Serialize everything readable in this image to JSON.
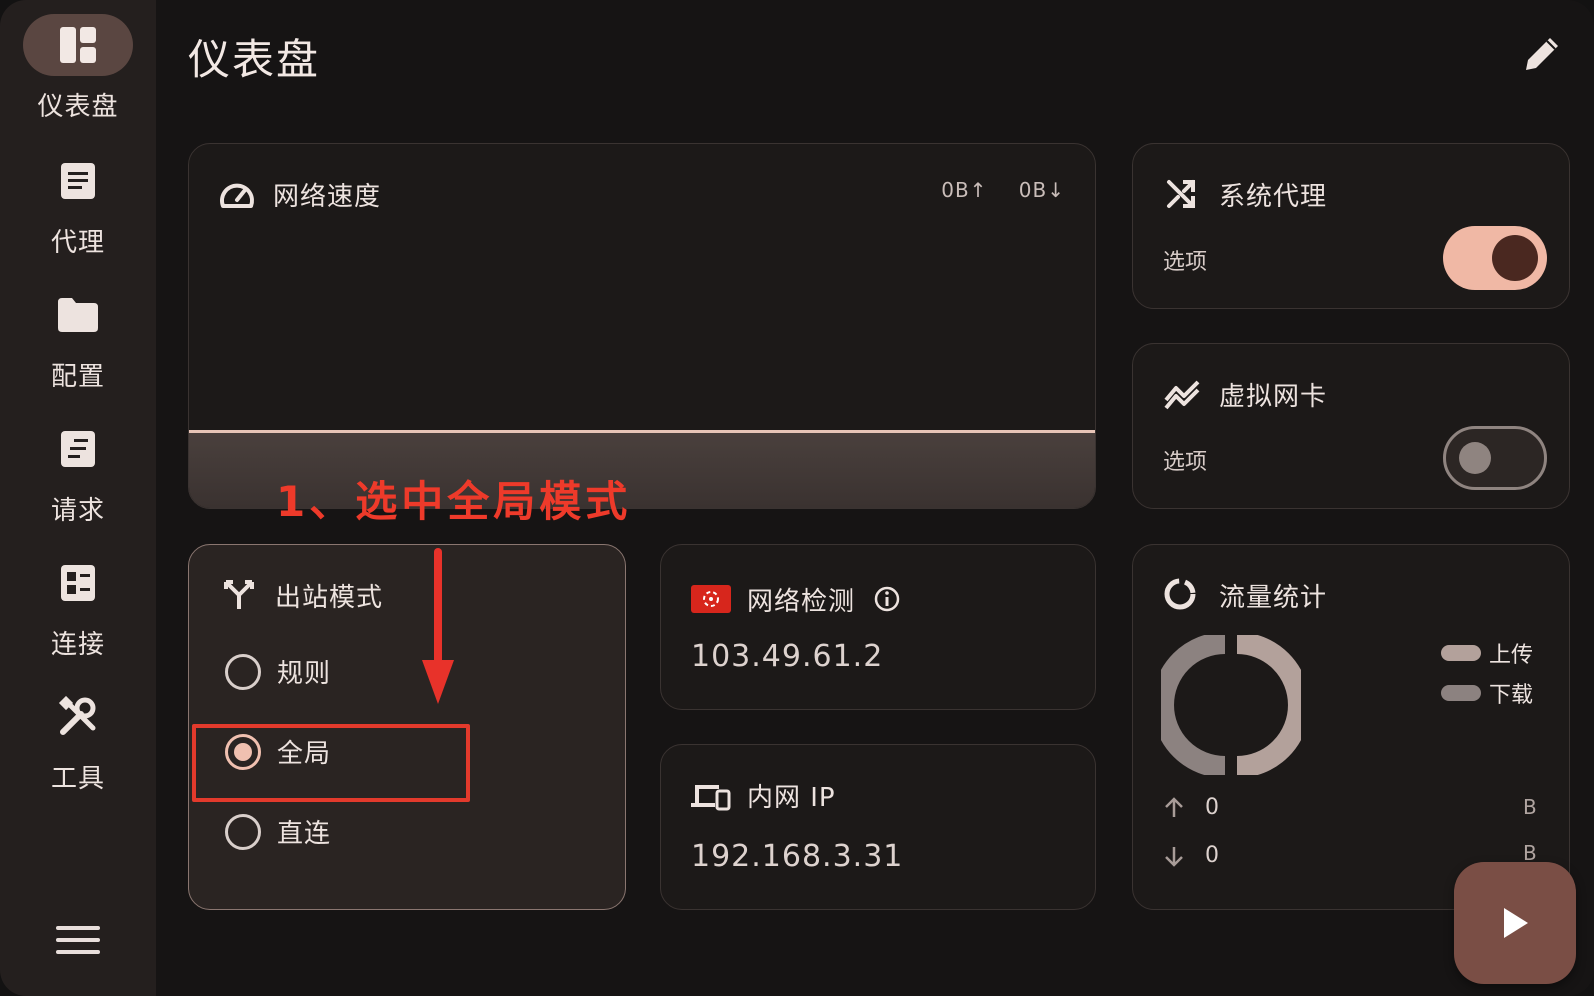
{
  "page": {
    "title": "仪表盘"
  },
  "sidebar": {
    "items": [
      {
        "label": "仪表盘",
        "icon": "dashboard-icon",
        "active": true
      },
      {
        "label": "代理",
        "icon": "proxy-list-icon"
      },
      {
        "label": "配置",
        "icon": "folder-icon"
      },
      {
        "label": "请求",
        "icon": "request-icon"
      },
      {
        "label": "连接",
        "icon": "connection-icon"
      },
      {
        "label": "工具",
        "icon": "tools-icon"
      }
    ],
    "menu_icon": "hamburger-menu-icon"
  },
  "speed": {
    "title": "网络速度",
    "up": "0B↑",
    "down": "0B↓",
    "icon": "speedometer-icon"
  },
  "system_proxy": {
    "title": "系统代理",
    "option": "选项",
    "enabled": true,
    "icon": "shuffle-icon"
  },
  "virtual_nic": {
    "title": "虚拟网卡",
    "option": "选项",
    "enabled": false,
    "icon": "trend-icon"
  },
  "outbound": {
    "title": "出站模式",
    "icon": "fork-icon",
    "options": [
      {
        "label": "规则",
        "selected": false
      },
      {
        "label": "全局",
        "selected": true
      },
      {
        "label": "直连",
        "selected": false
      }
    ]
  },
  "network_check": {
    "title": "网络检测",
    "value": "103.49.61.2",
    "flag_icon": "hong-kong-flag-icon",
    "info_icon": "info-icon"
  },
  "lan_ip": {
    "title": "内网 IP",
    "value": "192.168.3.31",
    "icon": "devices-icon"
  },
  "traffic": {
    "title": "流量统计",
    "icon": "donut-icon",
    "legend": [
      {
        "label": "上传",
        "color": "#b3a19b"
      },
      {
        "label": "下载",
        "color": "#8c8280"
      }
    ],
    "up_value": "0",
    "down_value": "0",
    "unit_up": "B",
    "unit_down": "B"
  },
  "annotation": {
    "text": "1、选中全局模式",
    "color": "#ee3a2a"
  },
  "colors": {
    "accent": "#f0b8a5",
    "background": "#161414",
    "sidebar": "#241f1e",
    "fab": "#7a4e45"
  }
}
